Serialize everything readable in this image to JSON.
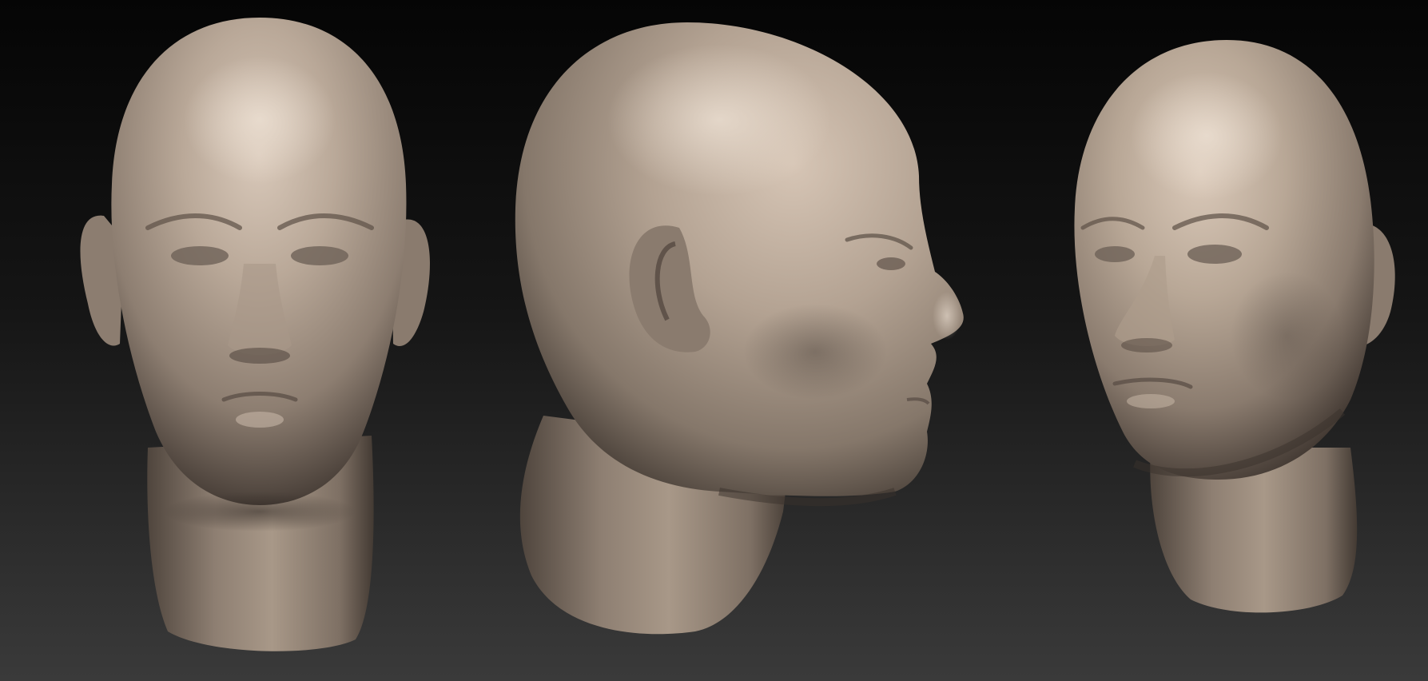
{
  "scene": {
    "background_top": "#050505",
    "background_bottom": "#3a3a3a",
    "material_light": "#cdbcad",
    "material_mid": "#9d8e80",
    "material_dark": "#4a4039",
    "views": [
      {
        "view": "front"
      },
      {
        "view": "side-profile"
      },
      {
        "view": "three-quarter"
      }
    ]
  }
}
